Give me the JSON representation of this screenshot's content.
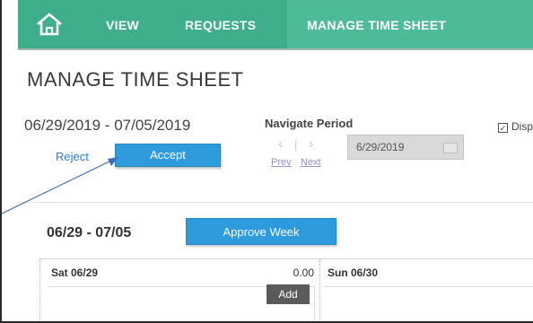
{
  "nav": {
    "home_icon": "home-icon",
    "tabs": [
      "VIEW",
      "REQUESTS",
      "MANAGE TIME SHEET"
    ],
    "active_tab": "MANAGE TIME SHEET",
    "color": "#3fae8a"
  },
  "page": {
    "title": "MANAGE TIME SHEET",
    "period": "06/29/2019 - 07/05/2019",
    "navigate_label": "Navigate Period",
    "prev_label": "Prev",
    "next_label": "Next",
    "date_value": "6/29/2019",
    "display_label": "Disp",
    "reject_label": "Reject",
    "accept_label": "Accept"
  },
  "week": {
    "range": "06/29 - 07/05",
    "approve_label": "Approve Week",
    "days": [
      {
        "label": "Sat 06/29",
        "hours": "0.00",
        "add_label": "Add"
      },
      {
        "label": "Sun 06/30"
      }
    ]
  },
  "colors": {
    "primary_button": "#2d9bdc",
    "link": "#2f7fd1"
  }
}
